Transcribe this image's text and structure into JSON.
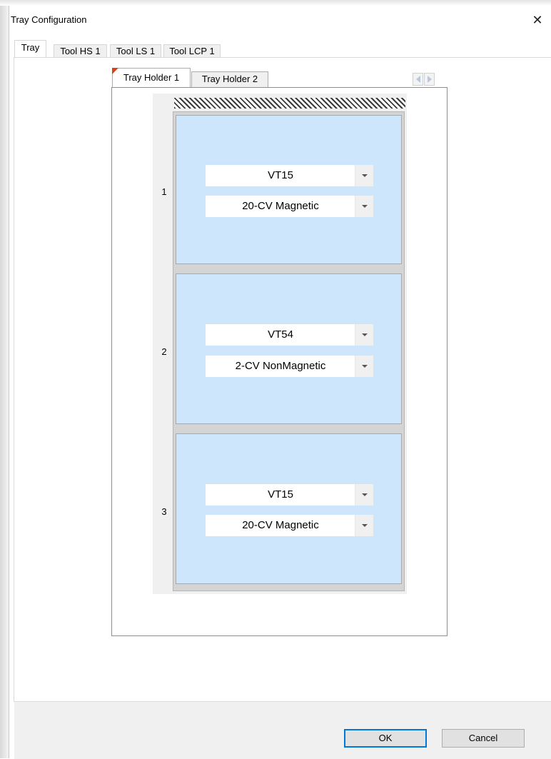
{
  "window": {
    "title": "Tray Configuration",
    "close_glyph": "✕"
  },
  "outer_tabs": [
    "Tray",
    "Tool HS 1",
    "Tool LS 1",
    "Tool LCP 1"
  ],
  "inner_tabs": [
    "Tray Holder 1",
    "Tray Holder 2"
  ],
  "slots": [
    {
      "number": "1",
      "type": "VT15",
      "mode": "20-CV Magnetic"
    },
    {
      "number": "2",
      "type": "VT54",
      "mode": "2-CV NonMagnetic"
    },
    {
      "number": "3",
      "type": "VT15",
      "mode": "20-CV Magnetic"
    }
  ],
  "buttons": {
    "ok": "OK",
    "cancel": "Cancel"
  },
  "colors": {
    "slot_fill": "#cde6fb",
    "accent": "#0078d7",
    "tab_marker": "#d84315"
  },
  "icons": {
    "close": "close-icon",
    "scroll_left": "chevron-left-icon",
    "scroll_right": "chevron-right-icon",
    "dropdown": "chevron-down-icon"
  }
}
